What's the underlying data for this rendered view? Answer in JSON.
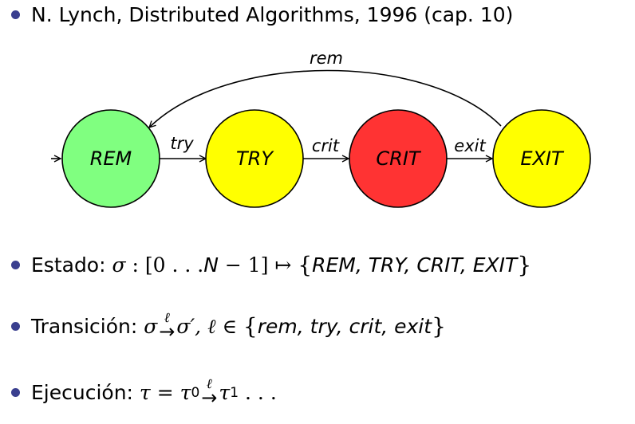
{
  "reference": "N. Lynch, Distributed Algorithms, 1996 (cap. 10)",
  "colors": {
    "bullet": "#3a3f8f",
    "edge": "#000000",
    "node_stroke": "#000000"
  },
  "diagram": {
    "states": [
      {
        "id": "rem",
        "label": "REM",
        "fill": "#80ff80"
      },
      {
        "id": "try",
        "label": "TRY",
        "fill": "#ffff00"
      },
      {
        "id": "crit",
        "label": "CRIT",
        "fill": "#ff3333"
      },
      {
        "id": "exit",
        "label": "EXIT",
        "fill": "#ffff00"
      }
    ],
    "transitions": [
      {
        "from": "rem",
        "to": "try",
        "label": "try"
      },
      {
        "from": "try",
        "to": "crit",
        "label": "crit"
      },
      {
        "from": "crit",
        "to": "exit",
        "label": "exit"
      },
      {
        "from": "exit",
        "to": "rem",
        "label": "rem"
      }
    ],
    "initial": "rem"
  },
  "definitions": {
    "estado": {
      "label": "Estado:",
      "sigma": "σ",
      "colon": ":",
      "domain_open": "[0 . . . ",
      "N": "N",
      "domain_minus": " − 1]",
      "mapsto": "↦",
      "set_open": "{",
      "set_items": "REM, TRY, CRIT, EXIT",
      "set_close": "}"
    },
    "transicion": {
      "label": "Transición:",
      "sigma": "σ",
      "ell": "ℓ",
      "arrow": "→",
      "sigma_prime": "σ′,",
      "ell2": "ℓ",
      "in": "∈",
      "set_open": "{",
      "set_items": "rem, try, crit, exit",
      "set_close": "}"
    },
    "ejecucion": {
      "label": "Ejecución:",
      "tau": "τ",
      "eq": "=",
      "tau0": "τ",
      "sub0": "0",
      "ell": "ℓ",
      "arrow": "→",
      "tau1": "τ",
      "sub1": "1",
      "dots": ". . ."
    }
  }
}
